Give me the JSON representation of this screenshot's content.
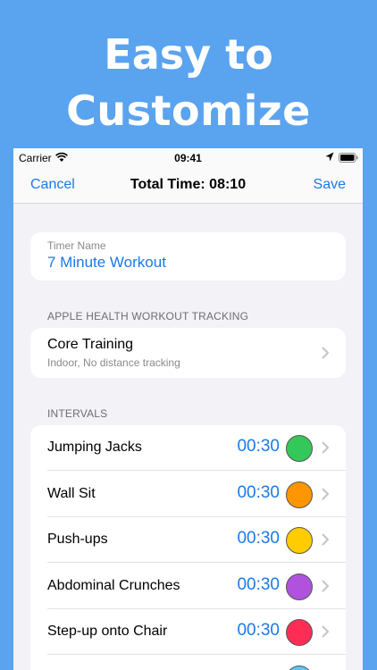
{
  "headline": {
    "line1": "Easy to",
    "line2": "Customize"
  },
  "status_bar": {
    "carrier": "Carrier",
    "time": "09:41"
  },
  "nav": {
    "cancel": "Cancel",
    "title": "Total Time: 08:10",
    "save": "Save"
  },
  "timer_name": {
    "label": "Timer Name",
    "value": "7 Minute Workout"
  },
  "health": {
    "section_header": "APPLE HEALTH WORKOUT TRACKING",
    "title": "Core Training",
    "subtitle": "Indoor, No distance tracking"
  },
  "intervals": {
    "section_header": "INTERVALS",
    "items": [
      {
        "name": "Jumping Jacks",
        "duration": "00:30",
        "color": "#34c759"
      },
      {
        "name": "Wall Sit",
        "duration": "00:30",
        "color": "#ff9500"
      },
      {
        "name": "Push-ups",
        "duration": "00:30",
        "color": "#ffcc00"
      },
      {
        "name": "Abdominal Crunches",
        "duration": "00:30",
        "color": "#af52de"
      },
      {
        "name": "Step-up onto Chair",
        "duration": "00:30",
        "color": "#ff2d55"
      },
      {
        "name": "",
        "duration": "",
        "color": "#5ac8fa"
      }
    ]
  },
  "colors": {
    "accent": "#1a7ae6",
    "background": "#5aa3ef"
  }
}
